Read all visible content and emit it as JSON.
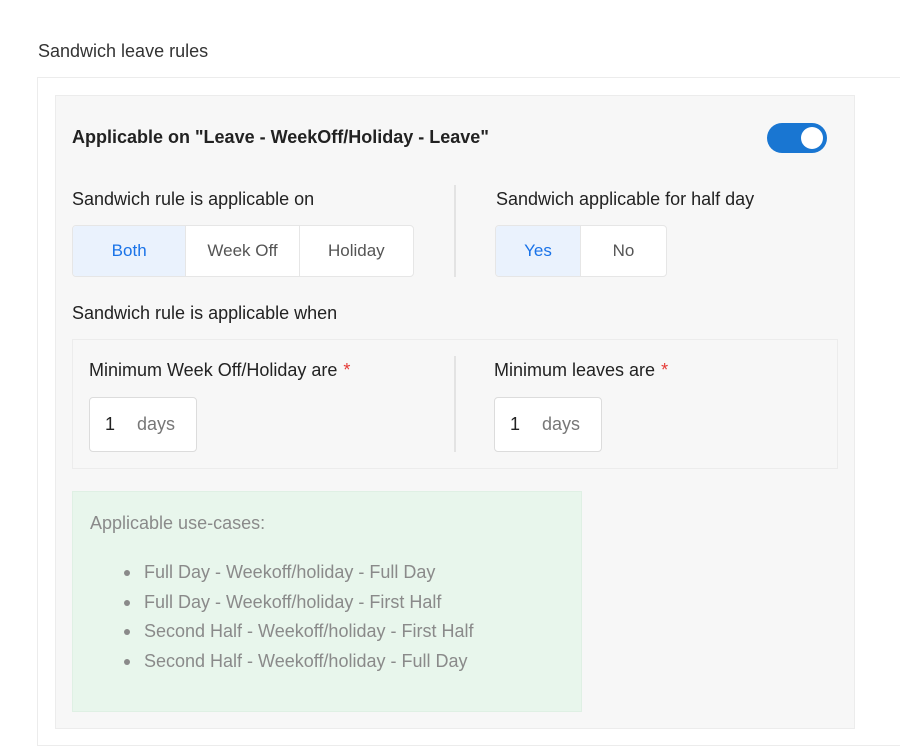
{
  "page": {
    "heading": "Sandwich leave rules"
  },
  "rule": {
    "title": "Applicable on \"Leave - WeekOff/Holiday - Leave\"",
    "enabled": true,
    "accent_color": "#1976d2"
  },
  "applicable_on": {
    "label": "Sandwich rule is applicable on",
    "options": [
      "Both",
      "Week Off",
      "Holiday"
    ],
    "selected": "Both"
  },
  "half_day": {
    "label": "Sandwich applicable for half day",
    "options": [
      "Yes",
      "No"
    ],
    "selected": "Yes"
  },
  "when": {
    "label": "Sandwich rule is applicable when",
    "min_weekoff": {
      "label": "Minimum Week Off/Holiday are",
      "required_mark": "*",
      "value": "1",
      "unit": "days"
    },
    "min_leaves": {
      "label": "Minimum leaves are",
      "required_mark": "*",
      "value": "1",
      "unit": "days"
    }
  },
  "usecases": {
    "title": "Applicable use-cases:",
    "items": [
      "Full Day - Weekoff/holiday - Full Day",
      "Full Day - Weekoff/holiday - First Half",
      "Second Half - Weekoff/holiday - First Half",
      "Second Half - Weekoff/holiday - Full Day"
    ],
    "background_color": "#e8f6ec"
  }
}
